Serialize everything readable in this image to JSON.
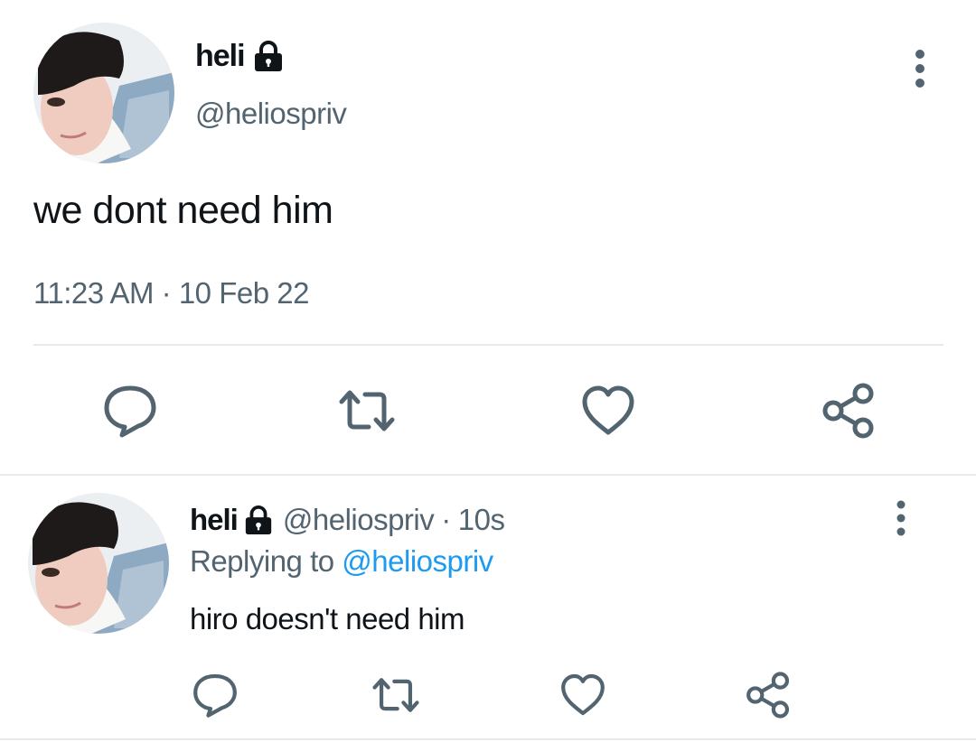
{
  "main_tweet": {
    "display_name": "heli",
    "handle": "@heliospriv",
    "text": "we dont need him",
    "time": "11:23 AM",
    "separator": "·",
    "date": "10 Feb 22",
    "protected": true,
    "icons": {
      "lock": "lock-icon",
      "more": "more-vertical-icon",
      "reply": "reply-bubble-icon",
      "retweet": "retweet-icon",
      "like": "heart-icon",
      "share": "share-icon"
    }
  },
  "reply_tweet": {
    "display_name": "heli",
    "handle": "@heliospriv",
    "separator": "·",
    "time_ago": "10s",
    "replying_prefix": "Replying to",
    "replying_to": "@heliospriv",
    "text": "hiro doesn't need him",
    "protected": true
  },
  "colors": {
    "text_primary": "#0f1419",
    "text_secondary": "#536471",
    "link": "#1d9bf0",
    "icon": "#536471",
    "divider": "#e7e9ea"
  }
}
